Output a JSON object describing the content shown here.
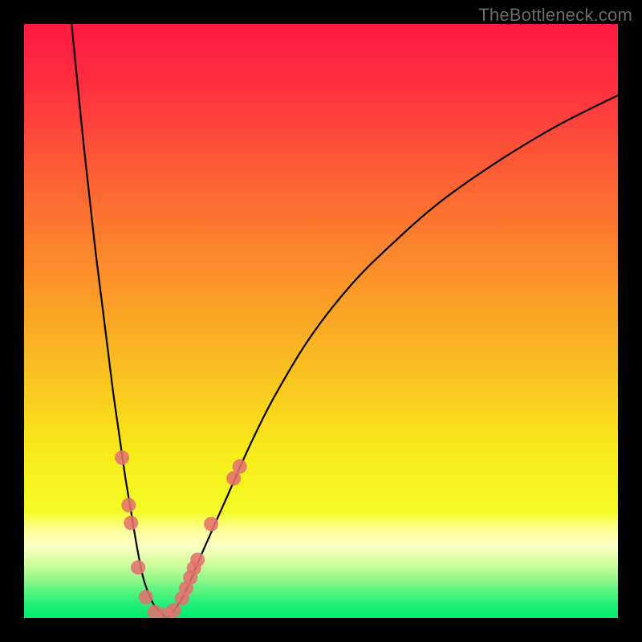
{
  "watermark": "TheBottleneck.com",
  "chart_data": {
    "type": "line",
    "title": "",
    "xlabel": "",
    "ylabel": "",
    "xlim": [
      0,
      100
    ],
    "ylim": [
      0,
      100
    ],
    "optimum_x": 20,
    "series": [
      {
        "name": "bottleneck-curve",
        "x": [
          8,
          9,
          10,
          11,
          12,
          13,
          14,
          15,
          16,
          17,
          18,
          19,
          20,
          21,
          22,
          23,
          24,
          25,
          27,
          30,
          34,
          38,
          42,
          48,
          55,
          62,
          70,
          80,
          90,
          100
        ],
        "y": [
          100,
          90,
          80,
          71,
          62,
          54,
          46,
          38,
          31,
          24,
          18,
          12,
          7,
          4,
          2,
          1,
          0,
          1,
          4,
          11,
          20,
          29,
          37,
          47,
          56,
          63,
          70,
          77,
          83,
          88
        ]
      }
    ],
    "markers": {
      "name": "highlighted-points",
      "color": "#e4716f",
      "points": [
        {
          "x": 16.5,
          "y": 27
        },
        {
          "x": 17.6,
          "y": 19
        },
        {
          "x": 18.0,
          "y": 16
        },
        {
          "x": 19.2,
          "y": 8.5
        },
        {
          "x": 20.5,
          "y": 3.5
        },
        {
          "x": 22.0,
          "y": 1.0
        },
        {
          "x": 23.8,
          "y": 0.5
        },
        {
          "x": 25.2,
          "y": 1.3
        },
        {
          "x": 26.6,
          "y": 3.3
        },
        {
          "x": 27.3,
          "y": 5.0
        },
        {
          "x": 28.0,
          "y": 6.8
        },
        {
          "x": 28.6,
          "y": 8.4
        },
        {
          "x": 29.2,
          "y": 9.8
        },
        {
          "x": 31.5,
          "y": 15.8
        },
        {
          "x": 35.3,
          "y": 23.5
        },
        {
          "x": 36.3,
          "y": 25.5
        }
      ]
    },
    "gradient_stops": [
      {
        "offset": 0.0,
        "color": "#fe1a40"
      },
      {
        "offset": 0.1,
        "color": "#fe2e3f"
      },
      {
        "offset": 0.22,
        "color": "#fd5537"
      },
      {
        "offset": 0.35,
        "color": "#fc7c2f"
      },
      {
        "offset": 0.48,
        "color": "#fba227"
      },
      {
        "offset": 0.6,
        "color": "#fac520"
      },
      {
        "offset": 0.72,
        "color": "#f8eb1a"
      },
      {
        "offset": 0.82,
        "color": "#f3fb24"
      },
      {
        "offset": 0.855,
        "color": "#ffff9e"
      },
      {
        "offset": 0.88,
        "color": "#fbffc5"
      },
      {
        "offset": 0.905,
        "color": "#d7fd9e"
      },
      {
        "offset": 0.93,
        "color": "#a0f98e"
      },
      {
        "offset": 0.955,
        "color": "#59f47f"
      },
      {
        "offset": 0.978,
        "color": "#1def73"
      },
      {
        "offset": 1.0,
        "color": "#00ec6e"
      }
    ]
  }
}
